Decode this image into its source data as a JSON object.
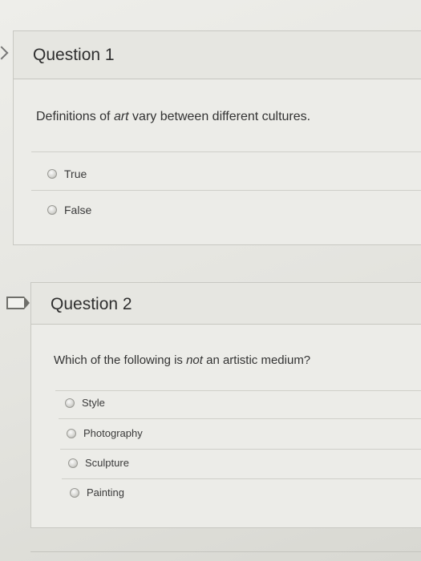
{
  "questions": [
    {
      "title": "Question 1",
      "text_before": "Definitions of ",
      "text_emph": "art",
      "text_after": " vary between different cultures.",
      "options": [
        "True",
        "False"
      ]
    },
    {
      "title": "Question 2",
      "text_before": "Which of the following is ",
      "text_emph": "not",
      "text_after": " an artistic medium?",
      "options": [
        "Style",
        "Photography",
        "Sculpture",
        "Painting"
      ]
    }
  ],
  "icons": {
    "nav_arrow": "chevron-right-icon",
    "flag_marker": "bookmark-flag-icon"
  }
}
